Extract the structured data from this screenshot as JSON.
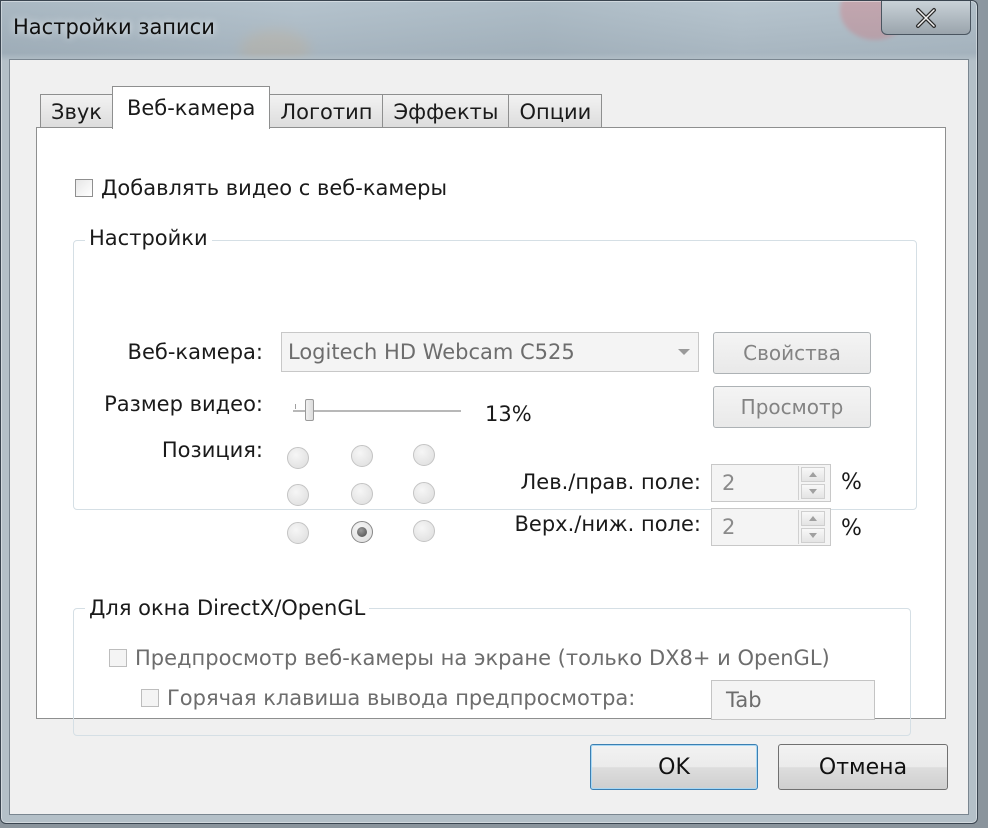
{
  "window": {
    "title": "Настройки записи"
  },
  "tabs": [
    {
      "label": "Звук"
    },
    {
      "label": "Веб-камера"
    },
    {
      "label": "Логотип"
    },
    {
      "label": "Эффекты"
    },
    {
      "label": "Опции"
    }
  ],
  "webcam": {
    "add_video_label": "Добавлять видео с веб-камеры",
    "add_video_checked": false,
    "settings": {
      "title": "Настройки",
      "camera_label": "Веб-камера:",
      "camera_value": "Logitech HD Webcam C525",
      "properties_button": "Свойства",
      "size_label": "Размер видео:",
      "size_value_text": "13%",
      "size_percent": 13,
      "preview_button": "Просмотр",
      "position_label": "Позиция:",
      "position_selected": "bottom-center",
      "lr_margin_label": "Лев./прав. поле:",
      "lr_margin_value": "2",
      "tb_margin_label": "Верх./ниж. поле:",
      "tb_margin_value": "2",
      "percent_sign": "%"
    },
    "directx": {
      "title": "Для окна DirectX/OpenGL",
      "onscreen_preview_label": "Предпросмотр веб-камеры на экране (только DX8+ и OpenGL)",
      "hotkey_label": "Горячая клавиша вывода предпросмотра:",
      "hotkey_value": "Tab"
    }
  },
  "footer": {
    "ok_button": "OK",
    "cancel_button": "Отмена"
  }
}
